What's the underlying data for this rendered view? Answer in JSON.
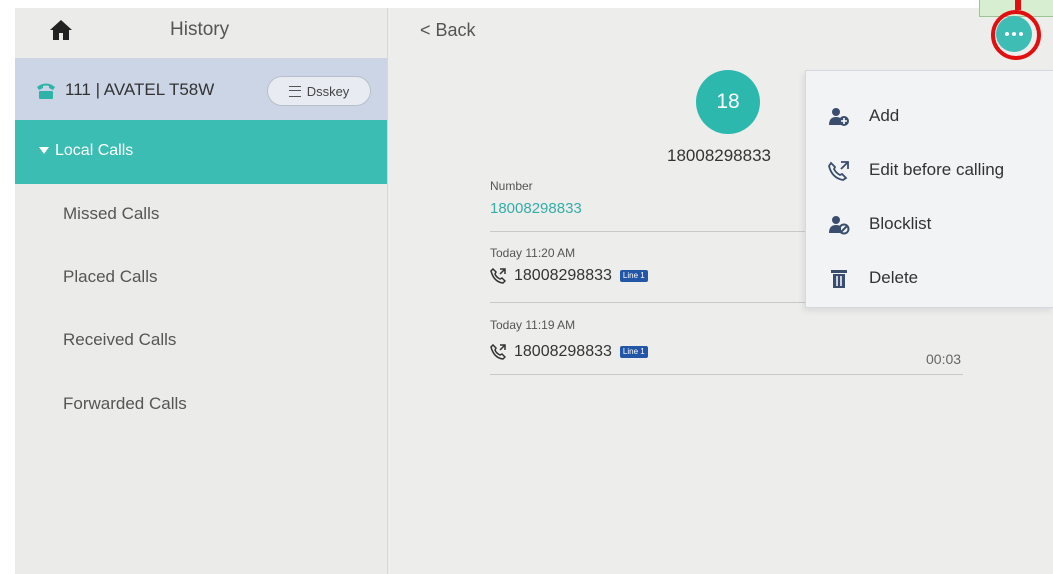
{
  "header": {
    "title": "History"
  },
  "account": {
    "label": "111 | AVATEL T58W",
    "dsskey_label": "Dsskey"
  },
  "sidebar": {
    "group_label": "Local Calls",
    "items": [
      {
        "label": "Missed Calls"
      },
      {
        "label": "Placed Calls"
      },
      {
        "label": "Received Calls"
      },
      {
        "label": "Forwarded Calls"
      }
    ]
  },
  "detail": {
    "back_label": "< Back",
    "avatar_text": "18",
    "contact_number": "18008298833",
    "number_label": "Number",
    "number_value": "18008298833",
    "records": [
      {
        "time": "Today 11:20 AM",
        "number": "18008298833",
        "line": "Line 1",
        "duration": ""
      },
      {
        "time": "Today 11:19 AM",
        "number": "18008298833",
        "line": "Line 1",
        "duration": "00:03"
      }
    ]
  },
  "menu": {
    "items": [
      {
        "label": "Add",
        "icon": "add-contact-icon"
      },
      {
        "label": "Edit before calling",
        "icon": "edit-call-icon"
      },
      {
        "label": "Blocklist",
        "icon": "blocklist-icon"
      },
      {
        "label": "Delete",
        "icon": "trash-icon"
      }
    ]
  },
  "colors": {
    "accent": "#3bbdb4",
    "account_bg": "#cbd5e6",
    "highlight": "#e01010",
    "line_badge": "#2456a8"
  }
}
